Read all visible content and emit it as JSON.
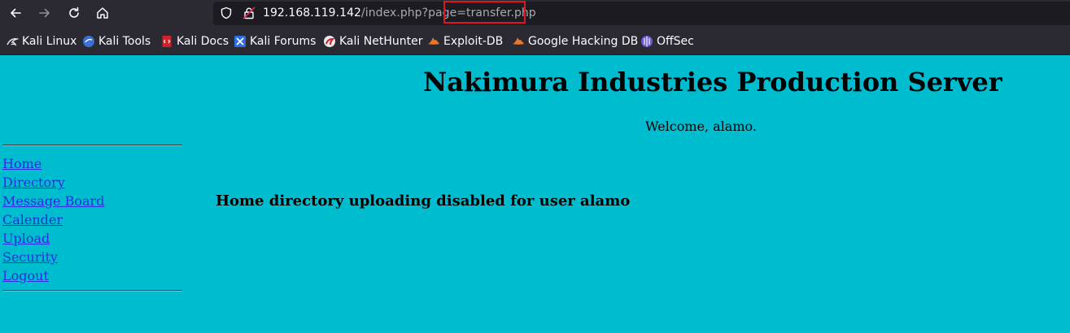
{
  "browser": {
    "url_host": "192.168.119.142",
    "url_path": "/index.php?page=",
    "url_highlight": "transfer.php",
    "bookmarks": [
      {
        "label": "Kali Linux",
        "icon": "kali-dragon-icon"
      },
      {
        "label": "Kali Tools",
        "icon": "kali-tools-icon"
      },
      {
        "label": "Kali Docs",
        "icon": "kali-docs-icon"
      },
      {
        "label": "Kali Forums",
        "icon": "kali-forums-icon"
      },
      {
        "label": "Kali NetHunter",
        "icon": "nethunter-icon"
      },
      {
        "label": "Exploit-DB",
        "icon": "exploit-db-icon"
      },
      {
        "label": "Google Hacking DB",
        "icon": "ghdb-icon"
      },
      {
        "label": "OffSec",
        "icon": "offsec-icon"
      }
    ],
    "highlight_color": "#e0141e"
  },
  "page": {
    "title": "Nakimura Industries Production Server",
    "welcome": "Welcome, alamo.",
    "background": "#00bccf",
    "nav": [
      {
        "label": "Home"
      },
      {
        "label": "Directory"
      },
      {
        "label": "Message Board"
      },
      {
        "label": "Calender"
      },
      {
        "label": "Upload"
      },
      {
        "label": "Security"
      },
      {
        "label": "Logout"
      }
    ],
    "notice": "Home directory uploading disabled for user alamo"
  }
}
